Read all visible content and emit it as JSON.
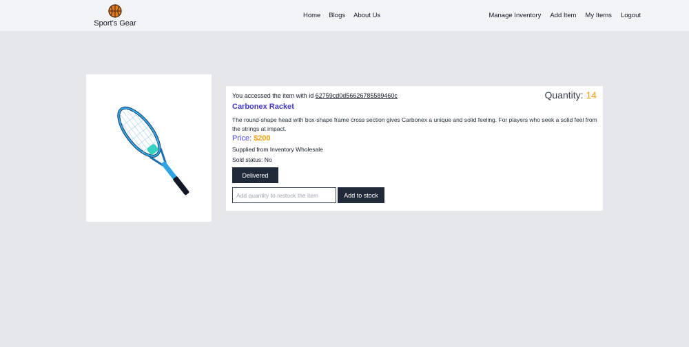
{
  "navbar": {
    "brand_name": "Sport's Gear",
    "brand_icon": "basketball-icon",
    "center_links": [
      "Home",
      "Blogs",
      "About Us"
    ],
    "right_links": [
      "Manage Inventory",
      "Add Item",
      "My Items",
      "Logout"
    ]
  },
  "item": {
    "access_prefix": "You accessed the item with id",
    "id": "62759cd0d56626785589460c",
    "quantity_label": "Quantity:",
    "quantity_value": "14",
    "name": "Carbonex Racket",
    "description": "The round-shape head with box-shape frame cross section gives Carbonex a unique and solid feeling. For players who seek a solid feel from the strings at impact.",
    "price_label": "Price:",
    "price_value": "$200",
    "supplier": "Supplied from Inventory Wholesale",
    "sold_status": "Sold status: No",
    "image_icon": "tennis-racket-image"
  },
  "actions": {
    "delivered_label": "Delivered",
    "restock_placeholder": "Add quantity to restock the item",
    "restock_value": "",
    "add_stock_label": "Add to stock"
  },
  "colors": {
    "page_background": "#e5e7eb",
    "navbar_background": "#f3f4f6",
    "title_color": "#4338ca",
    "accent_orange": "#f59e0b",
    "button_dark": "#1f2937"
  }
}
